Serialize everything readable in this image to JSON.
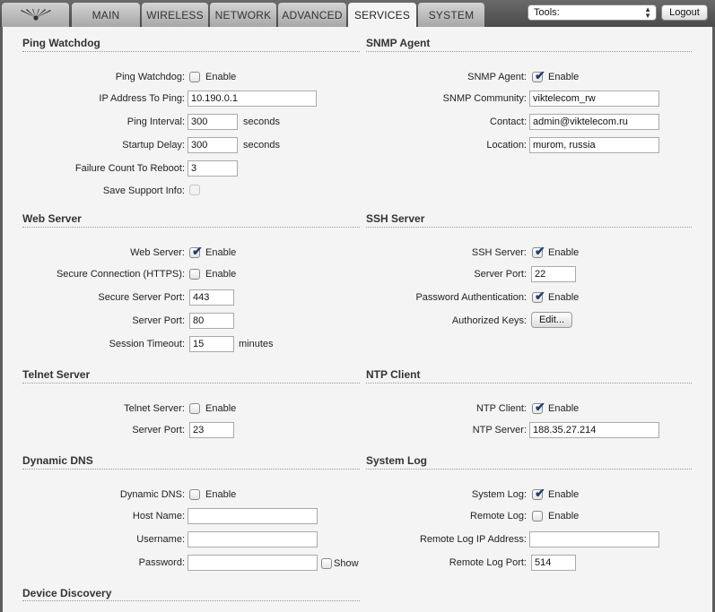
{
  "nav": {
    "tabs": [
      {
        "label": "MAIN"
      },
      {
        "label": "WIRELESS"
      },
      {
        "label": "NETWORK"
      },
      {
        "label": "ADVANCED"
      },
      {
        "label": "SERVICES",
        "active": true
      },
      {
        "label": "SYSTEM"
      }
    ],
    "tools_select": "Tools:",
    "logout_label": "Logout"
  },
  "common": {
    "enable": "Enable",
    "seconds": "seconds",
    "minutes": "minutes",
    "show": "Show"
  },
  "ping_watchdog": {
    "title": "Ping Watchdog",
    "enabled_label": "Ping Watchdog:",
    "enabled": false,
    "ip_label": "IP Address To Ping:",
    "ip": "10.190.0.1",
    "interval_label": "Ping Interval:",
    "interval": "300",
    "startup_label": "Startup Delay:",
    "startup": "300",
    "failure_label": "Failure Count To Reboot:",
    "failure": "3",
    "support_label": "Save Support Info:",
    "support": false
  },
  "snmp": {
    "title": "SNMP Agent",
    "enabled_label": "SNMP Agent:",
    "enabled": true,
    "community_label": "SNMP Community:",
    "community": "viktelecom_rw",
    "contact_label": "Contact:",
    "contact": "admin@viktelecom.ru",
    "location_label": "Location:",
    "location": "murom, russia"
  },
  "web_server": {
    "title": "Web Server",
    "enabled_label": "Web Server:",
    "enabled": true,
    "https_label": "Secure Connection (HTTPS):",
    "https": false,
    "secure_port_label": "Secure Server Port:",
    "secure_port": "443",
    "port_label": "Server Port:",
    "port": "80",
    "timeout_label": "Session Timeout:",
    "timeout": "15"
  },
  "ssh_server": {
    "title": "SSH Server",
    "enabled_label": "SSH Server:",
    "enabled": true,
    "port_label": "Server Port:",
    "port": "22",
    "password_label": "Password Authentication:",
    "password": true,
    "keys_label": "Authorized Keys:",
    "keys_button": "Edit..."
  },
  "telnet": {
    "title": "Telnet Server",
    "enabled_label": "Telnet Server:",
    "enabled": false,
    "port_label": "Server Port:",
    "port": "23"
  },
  "ntp": {
    "title": "NTP Client",
    "enabled_label": "NTP Client:",
    "enabled": true,
    "server_label": "NTP Server:",
    "server": "188.35.27.214"
  },
  "ddns": {
    "title": "Dynamic DNS",
    "enabled_label": "Dynamic DNS:",
    "enabled": false,
    "host_label": "Host Name:",
    "host": "",
    "user_label": "Username:",
    "user": "",
    "pass_label": "Password:",
    "pass": "",
    "show": false
  },
  "syslog": {
    "title": "System Log",
    "enabled_label": "System Log:",
    "enabled": true,
    "remote_label": "Remote Log:",
    "remote": false,
    "remote_ip_label": "Remote Log IP Address:",
    "remote_ip": "",
    "remote_port_label": "Remote Log Port:",
    "remote_port": "514"
  },
  "discovery": {
    "title": "Device Discovery"
  }
}
